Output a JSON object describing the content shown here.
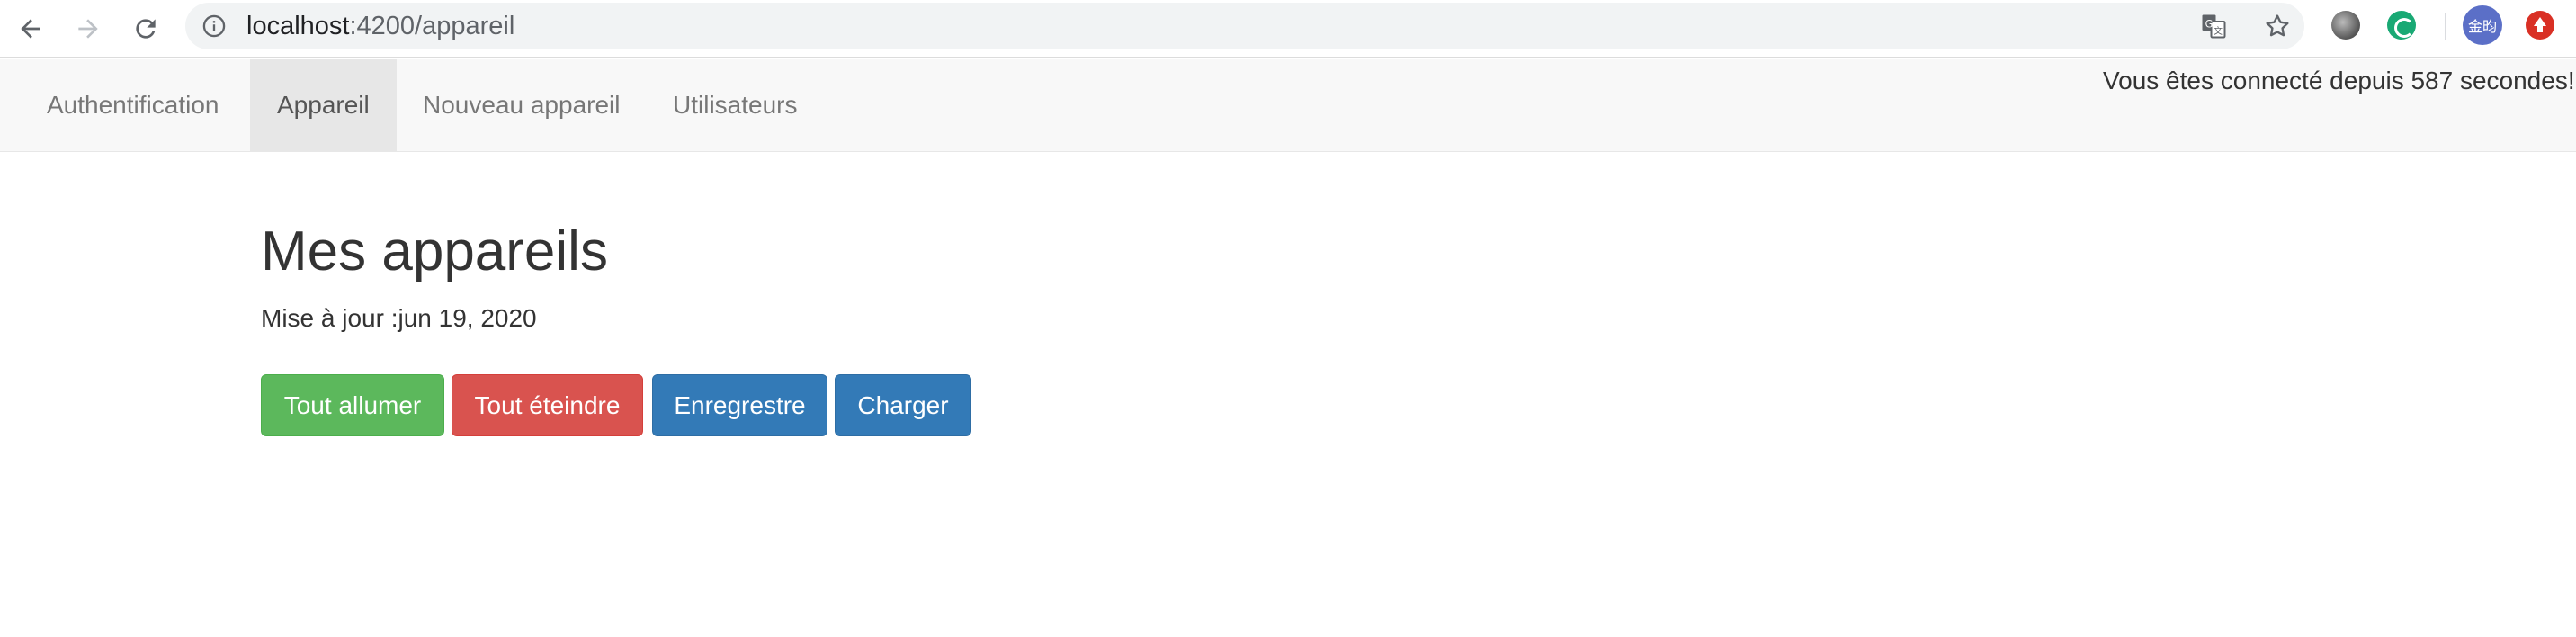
{
  "browser": {
    "url_host": "localhost",
    "url_path": ":4200/appareil",
    "avatar_text": "金昀",
    "icons": [
      "back-arrow-icon",
      "forward-arrow-icon",
      "reload-icon",
      "info-icon",
      "translate-icon",
      "star-icon"
    ]
  },
  "navbar": {
    "items": [
      {
        "label": "Authentification"
      },
      {
        "label": "Appareil"
      },
      {
        "label": "Nouveau appareil"
      },
      {
        "label": "Utilisateurs"
      }
    ],
    "status": "Vous êtes connecté depuis 587 secondes!"
  },
  "main": {
    "title": "Mes appareils",
    "last_update": "Mise à jour :jun 19, 2020",
    "buttons": {
      "all_on": "Tout allumer",
      "all_off": "Tout éteindre",
      "save": "Enregrestre",
      "load": "Charger"
    }
  },
  "colors": {
    "success": "#5cb85c",
    "danger": "#d9534f",
    "primary": "#337ab7",
    "navbar_bg": "#f8f8f8"
  }
}
